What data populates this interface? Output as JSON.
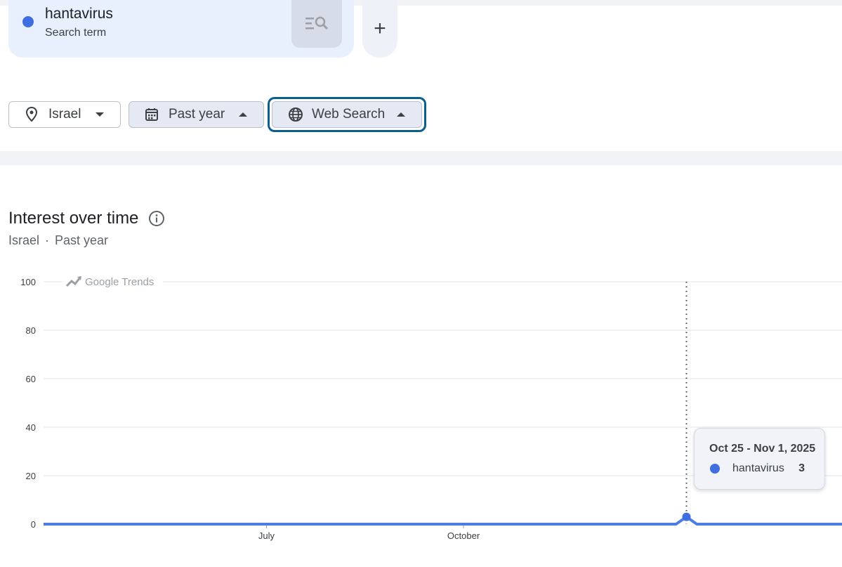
{
  "search_term": {
    "name": "hantavirus",
    "label": "Search term",
    "color": "#3f6ee0"
  },
  "add_button": {
    "label": "+"
  },
  "filters": {
    "location": {
      "label": "Israel",
      "icon": "location-pin-icon"
    },
    "time": {
      "label": "Past year",
      "icon": "calendar-icon"
    },
    "property": {
      "label": "Web Search",
      "icon": "globe-icon"
    }
  },
  "section": {
    "title": "Interest over time",
    "sub_location": "Israel",
    "sub_separator": "·",
    "sub_time": "Past year"
  },
  "watermark": "Google Trends",
  "tooltip": {
    "date": "Oct 25 - Nov 1, 2025",
    "series": "hantavirus",
    "value": "3"
  },
  "chart_data": {
    "type": "line",
    "y_ticks": [
      "100",
      "80",
      "60",
      "40",
      "20",
      "0"
    ],
    "ylim": [
      0,
      100
    ],
    "x_tick_labels": [
      {
        "label": "July",
        "week": 21.5
      },
      {
        "label": "October",
        "week": 40.5
      }
    ],
    "series": [
      {
        "name": "hantavirus",
        "color": "#4a7ee6",
        "values": [
          0,
          0,
          0,
          0,
          0,
          0,
          0,
          0,
          0,
          0,
          0,
          0,
          0,
          0,
          0,
          0,
          0,
          0,
          0,
          0,
          0,
          0,
          0,
          0,
          0,
          0,
          0,
          0,
          0,
          0,
          0,
          0,
          0,
          0,
          0,
          0,
          0,
          0,
          0,
          0,
          0,
          0,
          0,
          0,
          0,
          0,
          0,
          0,
          0,
          0,
          0,
          0,
          0,
          0,
          0,
          0,
          0,
          0,
          0,
          0,
          0,
          0,
          3,
          0,
          0,
          0,
          0,
          0,
          0,
          0,
          0,
          0,
          0,
          0,
          0,
          0,
          0,
          0
        ]
      }
    ],
    "highlight_index": 62,
    "grid": true
  }
}
